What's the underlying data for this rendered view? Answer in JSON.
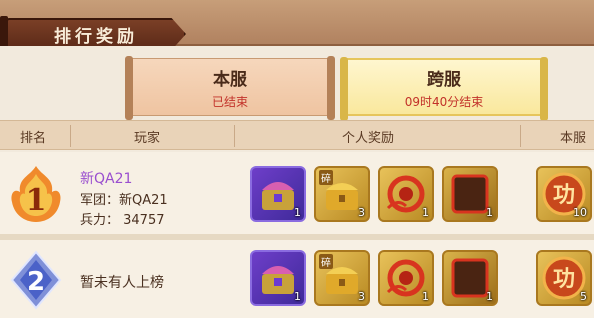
{
  "header": {
    "title": "排行奖励"
  },
  "tabs": [
    {
      "title": "本服",
      "status": "已结束"
    },
    {
      "title": "跨服",
      "status": "09时40分结束"
    }
  ],
  "columns": [
    "排名",
    "玩家",
    "个人奖励",
    "本服"
  ],
  "rows": [
    {
      "rank": "1",
      "player_name": "新QA21",
      "legion": "军团：新QA21",
      "power": "兵力： 34757",
      "items": [
        {
          "icon": "purple-chest-icon",
          "qty": "1"
        },
        {
          "icon": "gold-chest-icon",
          "tag": "碎",
          "qty": "3"
        },
        {
          "icon": "red-token-icon",
          "qty": "1"
        },
        {
          "icon": "dark-frame-icon",
          "qty": "1"
        }
      ],
      "server_reward": {
        "icon": "gong-medal-icon",
        "qty": "10"
      }
    },
    {
      "rank": "2",
      "empty_text": "暂未有人上榜",
      "items": [
        {
          "icon": "purple-chest-icon",
          "qty": "1"
        },
        {
          "icon": "gold-chest-icon",
          "tag": "碎",
          "qty": "3"
        },
        {
          "icon": "red-token-icon",
          "qty": "1"
        },
        {
          "icon": "dark-frame-icon",
          "qty": "1"
        }
      ],
      "server_reward": {
        "icon": "gong-medal-icon",
        "qty": "5"
      }
    }
  ],
  "gong_glyph": "功"
}
